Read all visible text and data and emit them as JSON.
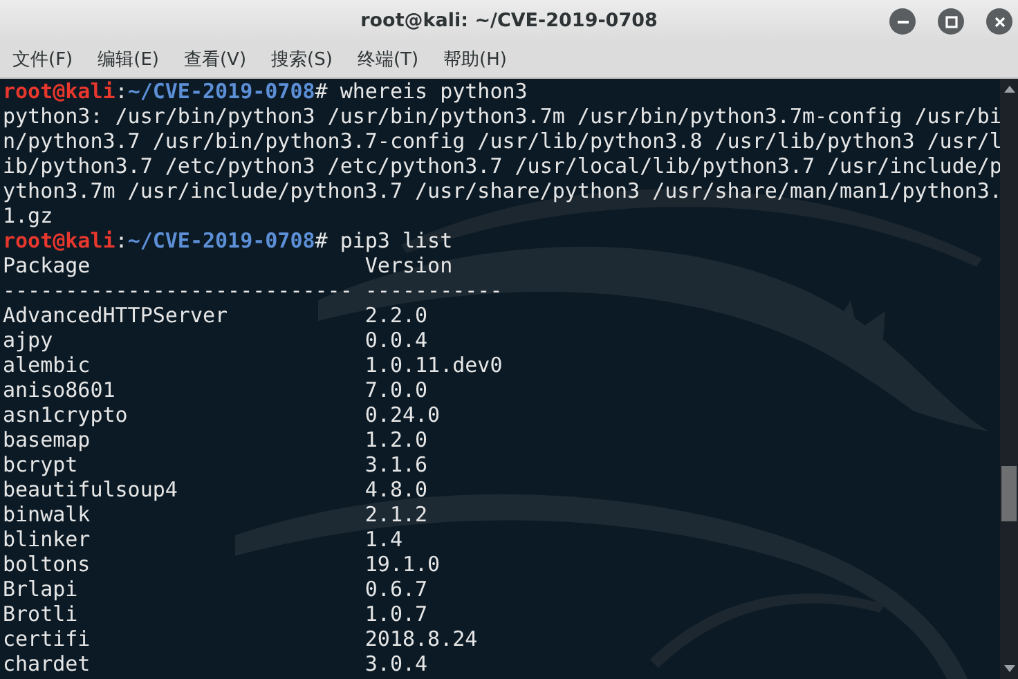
{
  "window": {
    "title": "root@kali: ~/CVE-2019-0708"
  },
  "menu": [
    "文件(F)",
    "编辑(E)",
    "查看(V)",
    "搜索(S)",
    "终端(T)",
    "帮助(H)"
  ],
  "terminal": {
    "lines": [
      {
        "kind": "prompt",
        "user": "root@kali",
        "separator": ":",
        "path": "~/CVE-2019-0708",
        "symbol": "#",
        "command": "whereis python3"
      },
      {
        "kind": "output",
        "text": "python3: /usr/bin/python3 /usr/bin/python3.7m /usr/bin/python3.7m-config /usr/bi"
      },
      {
        "kind": "output",
        "text": "n/python3.7 /usr/bin/python3.7-config /usr/lib/python3.8 /usr/lib/python3 /usr/l"
      },
      {
        "kind": "output",
        "text": "ib/python3.7 /etc/python3 /etc/python3.7 /usr/local/lib/python3.7 /usr/include/p"
      },
      {
        "kind": "output",
        "text": "ython3.7m /usr/include/python3.7 /usr/share/python3 /usr/share/man/man1/python3."
      },
      {
        "kind": "output",
        "text": "1.gz"
      },
      {
        "kind": "prompt",
        "user": "root@kali",
        "separator": ":",
        "path": "~/CVE-2019-0708",
        "symbol": "#",
        "command": "pip3 list"
      },
      {
        "kind": "columns",
        "cells": [
          "Package",
          "Version"
        ]
      },
      {
        "kind": "columns",
        "cells": [
          "----------------------------",
          "-----------"
        ]
      },
      {
        "kind": "columns",
        "cells": [
          "AdvancedHTTPServer",
          "2.2.0"
        ]
      },
      {
        "kind": "columns",
        "cells": [
          "ajpy",
          "0.0.4"
        ]
      },
      {
        "kind": "columns",
        "cells": [
          "alembic",
          "1.0.11.dev0"
        ]
      },
      {
        "kind": "columns",
        "cells": [
          "aniso8601",
          "7.0.0"
        ]
      },
      {
        "kind": "columns",
        "cells": [
          "asn1crypto",
          "0.24.0"
        ]
      },
      {
        "kind": "columns",
        "cells": [
          "basemap",
          "1.2.0"
        ]
      },
      {
        "kind": "columns",
        "cells": [
          "bcrypt",
          "3.1.6"
        ]
      },
      {
        "kind": "columns",
        "cells": [
          "beautifulsoup4",
          "4.8.0"
        ]
      },
      {
        "kind": "columns",
        "cells": [
          "binwalk",
          "2.1.2"
        ]
      },
      {
        "kind": "columns",
        "cells": [
          "blinker",
          "1.4"
        ]
      },
      {
        "kind": "columns",
        "cells": [
          "boltons",
          "19.1.0"
        ]
      },
      {
        "kind": "columns",
        "cells": [
          "Brlapi",
          "0.6.7"
        ]
      },
      {
        "kind": "columns",
        "cells": [
          "Brotli",
          "1.0.7"
        ]
      },
      {
        "kind": "columns",
        "cells": [
          "certifi",
          "2018.8.24"
        ]
      },
      {
        "kind": "columns",
        "cells": [
          "chardet",
          "3.0.4"
        ]
      }
    ]
  }
}
